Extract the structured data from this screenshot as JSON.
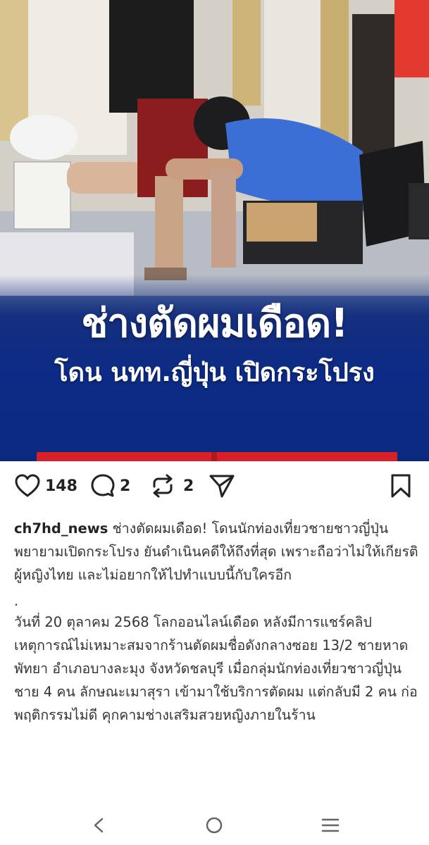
{
  "post": {
    "headline_line1": "ช่างตัดผมเดือด!",
    "headline_line2": "โดน นทท.ญี่ปุ่น เปิดกระโปรง"
  },
  "actions": {
    "likes": "148",
    "comments": "2",
    "reposts": "2"
  },
  "caption": {
    "username": "ch7hd_news",
    "lead": " ช่างตัดผมเดือด! โดนนักท่องเที่ยวชายชาวญี่ปุ่นพยายามเปิดกระโปรง ยันดำเนินคดีให้ถึงที่สุด เพราะถือว่าไม่ให้เกียรติผู้หญิงไทย และไม่อยากให้ไปทำแบบนี้กับใครอีก",
    "dot": ".",
    "body": "วันที่ 20 ตุลาคม 2568 โลกออนไลน์เดือด หลังมีการแชร์คลิปเหตุการณ์ไม่เหมาะสมจากร้านตัดผมชื่อดังกลางซอย 13/2 ชายหาดพัทยา อำเภอบางละมุง จังหวัดชลบุรี เมื่อกลุ่มนักท่องเที่ยวชาวญี่ปุ่นชาย 4 คน ลักษณะเมาสุรา เข้ามาใช้บริการตัดผม แต่กลับมี 2 คน ก่อพฤติกรรมไม่ดี คุกคามช่างเสริมสวยหญิงภายในร้าน"
  },
  "icons": {
    "like": "heart-icon",
    "comment": "comment-icon",
    "repost": "repost-icon",
    "share": "send-icon",
    "save": "bookmark-icon",
    "back": "back-icon",
    "home": "home-icon",
    "recents": "recents-icon"
  }
}
